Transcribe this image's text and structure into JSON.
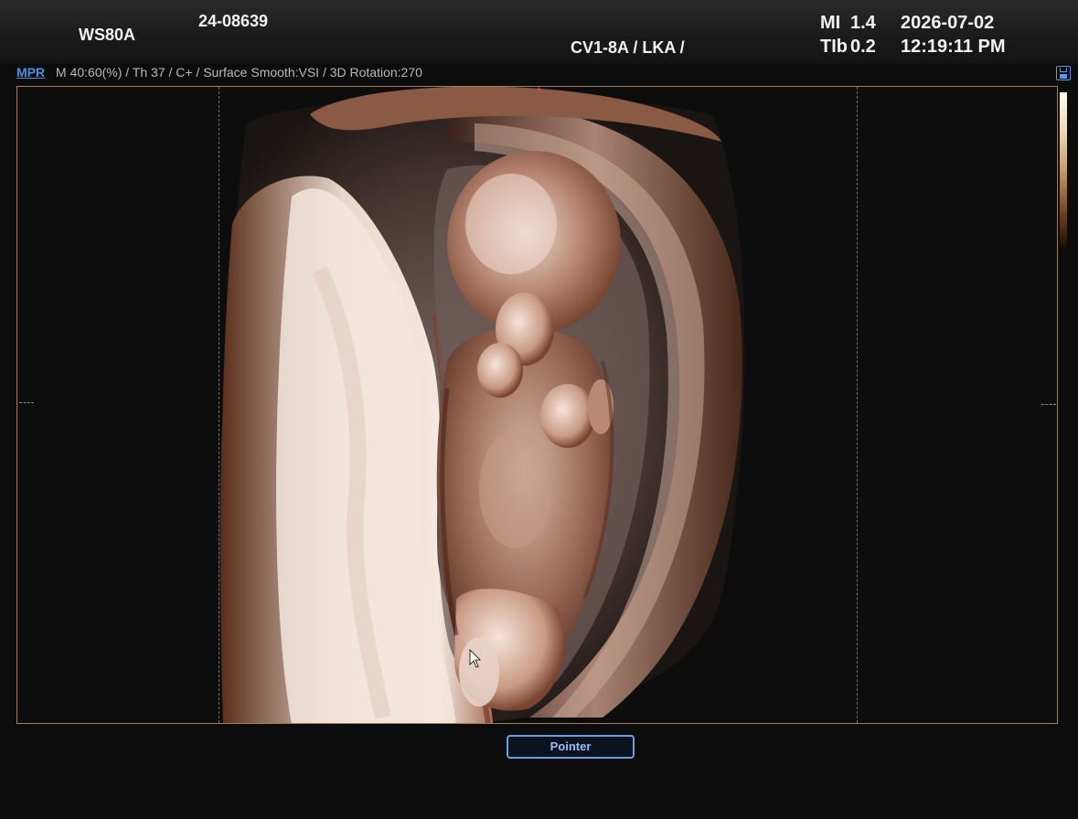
{
  "header": {
    "model": "WS80A",
    "patient_id": "24-08639",
    "probe": "CV1-8A / LKA /",
    "mi_label": "MI",
    "mi_value": "1.4",
    "tib_label": "TIb",
    "tib_value": "0.2",
    "date": "2026-07-02",
    "time": "12:19:11 PM"
  },
  "status": {
    "mpr_label": "MPR",
    "params": "M 40:60(%) / Th 37 / C+ / Surface Smooth:VSI / 3D Rotation:270"
  },
  "footer": {
    "pointer_label": "Pointer"
  },
  "colors": {
    "accent": "#4f8fe0",
    "viewport_border": "#a07e60",
    "tissue_light": "#f0e1d6",
    "tissue_dark": "#6a3820"
  },
  "icons": {
    "save": "save-icon",
    "cursor": "mouse-pointer-icon"
  }
}
